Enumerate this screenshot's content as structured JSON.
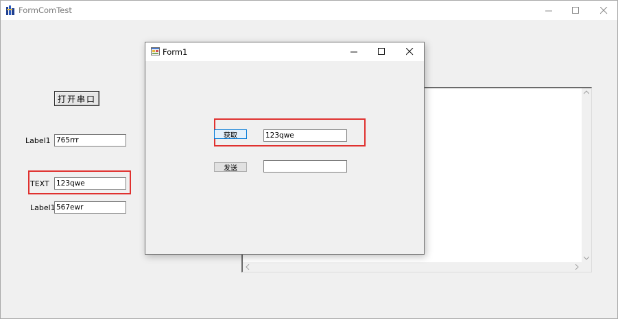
{
  "main_window": {
    "title": "FormComTest",
    "open_port_button": "打开串口",
    "label1_top": "Label1",
    "label1_top_value": "765rrr",
    "text_label": "TEXT",
    "text_value": "123qwe",
    "label1_bottom": "Label1",
    "label1_bottom_value": "567ewr"
  },
  "form1": {
    "title": "Form1",
    "get_button": "获取",
    "get_value": "123qwe",
    "send_button": "发送",
    "send_value": ""
  },
  "colors": {
    "highlight_red": "#e0312f",
    "window_bg": "#f0f0f0"
  }
}
